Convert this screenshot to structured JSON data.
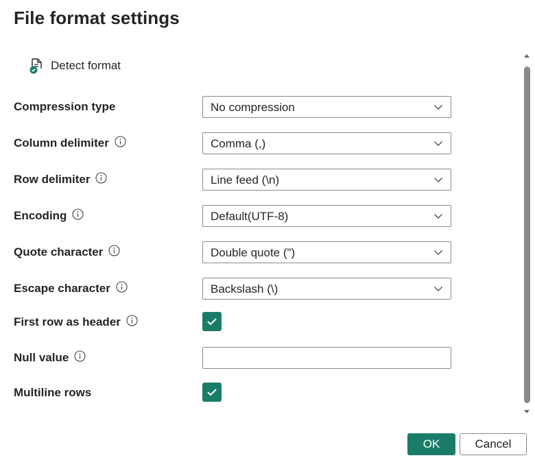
{
  "dialog": {
    "title": "File format settings"
  },
  "detect": {
    "label": "Detect format",
    "icon": "document-check-icon"
  },
  "fields": {
    "compression": {
      "label": "Compression type",
      "value": "No compression"
    },
    "column_delimiter": {
      "label": "Column delimiter",
      "value": "Comma (,)"
    },
    "row_delimiter": {
      "label": "Row delimiter",
      "value": "Line feed (\\n)"
    },
    "encoding": {
      "label": "Encoding",
      "value": "Default(UTF-8)"
    },
    "quote_character": {
      "label": "Quote character",
      "value": "Double quote (\")"
    },
    "escape_character": {
      "label": "Escape character",
      "value": "Backslash (\\)"
    },
    "first_row_header": {
      "label": "First row as header",
      "checked": true
    },
    "null_value": {
      "label": "Null value",
      "value": ""
    },
    "multiline_rows": {
      "label": "Multiline rows",
      "checked": true
    }
  },
  "buttons": {
    "ok": "OK",
    "cancel": "Cancel"
  },
  "colors": {
    "accent": "#1a7c68",
    "text": "#242424",
    "border": "#8a8a8a"
  }
}
